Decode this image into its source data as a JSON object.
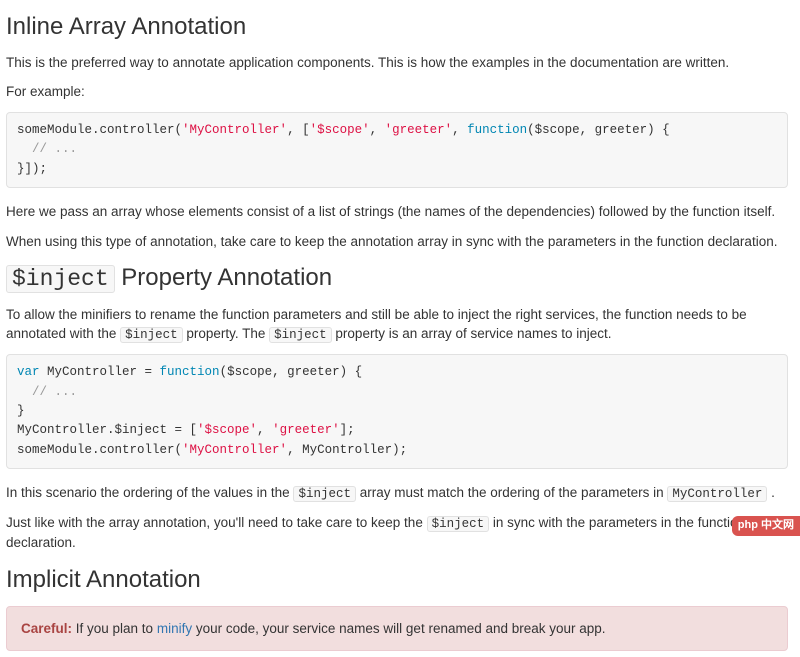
{
  "section1": {
    "heading": "Inline Array Annotation",
    "p1": "This is the preferred way to annotate application components. This is how the examples in the documentation are written.",
    "p2": "For example:",
    "code": {
      "l1a": "someModule.controller(",
      "l1b": "'MyController'",
      "l1c": ", [",
      "l1d": "'$scope'",
      "l1e": ", ",
      "l1f": "'greeter'",
      "l1g": ", ",
      "l1h": "function",
      "l1i": "($scope, greeter) {",
      "l2": "  // ...",
      "l3": "}]);"
    },
    "p3": "Here we pass an array whose elements consist of a list of strings (the names of the dependencies) followed by the function itself.",
    "p4": "When using this type of annotation, take care to keep the annotation array in sync with the parameters in the function declaration."
  },
  "section2": {
    "heading_code": "$inject",
    "heading_rest": " Property Annotation",
    "p1a": "To allow the minifiers to rename the function parameters and still be able to inject the right services, the function needs to be annotated with the ",
    "p1code1": "$inject",
    "p1b": " property. The ",
    "p1code2": "$inject",
    "p1c": " property is an array of service names to inject.",
    "code": {
      "l1a": "var",
      "l1b": " MyController = ",
      "l1c": "function",
      "l1d": "($scope, greeter) {",
      "l2": "  // ...",
      "l3": "}",
      "l4a": "MyController.$inject = [",
      "l4b": "'$scope'",
      "l4c": ", ",
      "l4d": "'greeter'",
      "l4e": "];",
      "l5a": "someModule.controller(",
      "l5b": "'MyController'",
      "l5c": ", MyController);"
    },
    "p2a": "In this scenario the ordering of the values in the ",
    "p2code1": "$inject",
    "p2b": " array must match the ordering of the parameters in ",
    "p2code2": "MyController",
    "p2c": " .",
    "p3a": "Just like with the array annotation, you'll need to take care to keep the ",
    "p3code1": "$inject",
    "p3b": " in sync with the parameters in the function declaration."
  },
  "section3": {
    "heading": "Implicit Annotation",
    "alert_strong": "Careful:",
    "alert_a": " If you plan to ",
    "alert_link": "minify",
    "alert_b": " your code, your service names will get renamed and break your app."
  },
  "corner_badge": "php 中文网"
}
